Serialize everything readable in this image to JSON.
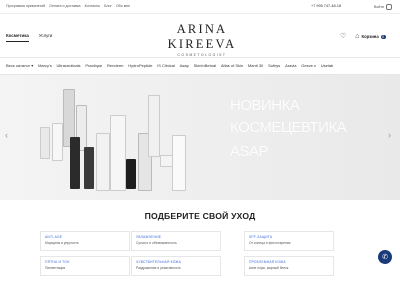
{
  "topbar": {
    "links": [
      "Программа привилегий",
      "Оплата и доставка",
      "Контакты",
      "Блог",
      "Обо мне"
    ],
    "phone": "+7 995 747-48-18",
    "login": "Войти"
  },
  "tabs": [
    "Косметика",
    "Услуги"
  ],
  "logo": {
    "name": "ARINA KIREEVA",
    "subtitle": "COSMETOLOGIST"
  },
  "header": {
    "cart_label": "Корзина",
    "cart_count": "0"
  },
  "nav": {
    "items": [
      "Весь каталог",
      "Marcy's",
      "Ultraceuticals",
      "Practique",
      "Renderm",
      "HydroPeptide",
      "iS Clinical",
      "Asap",
      "SkinInBetual",
      "Alfas of Skin",
      "Manti 30",
      "Sothys",
      "Aravia",
      "Gesve.x",
      "Uselab"
    ]
  },
  "hero": {
    "line1": "НОВИНКА",
    "line2": "КОСМЕЦЕВТИКА",
    "line3": "ASAP"
  },
  "section_title": "ПОДБЕРИТЕ СВОЙ УХОД",
  "cards": [
    {
      "title": "ANTI-AGE",
      "subtitle": "Морщины и упругость"
    },
    {
      "title": "УВЛАЖНЕНИЕ",
      "subtitle": "Сухость и обезвоженность"
    },
    {
      "title": "SPF-ЗАЩИТА",
      "subtitle": "От солнца и фотостарения"
    },
    {
      "title": "ПЯТНА И ТОН",
      "subtitle": "Пигментация"
    },
    {
      "title": "ЧУВСТВИТЕЛЬНАЯ КОЖА",
      "subtitle": "Раздражение и реактивность"
    },
    {
      "title": "ПРОБЛЕМНАЯ КОЖА",
      "subtitle": "Акне поры, жирный блеск"
    }
  ],
  "colors": {
    "accent": "#1d3a7a",
    "card_title": "#3a6ad6"
  }
}
